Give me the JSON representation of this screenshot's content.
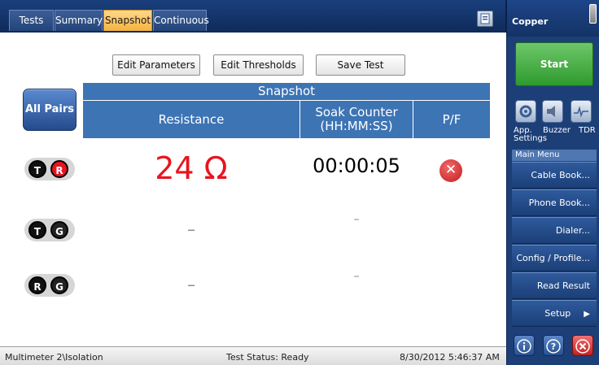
{
  "tabs": {
    "tests": "Tests",
    "summary": "Summary",
    "snapshot": "Snapshot",
    "continuous": "Continuous",
    "active": "Snapshot"
  },
  "toolbar": {
    "edit_parameters": "Edit Parameters",
    "edit_thresholds": "Edit Thresholds",
    "save_test": "Save Test"
  },
  "table": {
    "all_pairs_label": "All Pairs",
    "title": "Snapshot",
    "columns": {
      "resistance": "Resistance",
      "soak_counter_line1": "Soak Counter",
      "soak_counter_line2": "(HH:MM:SS)",
      "pf": "P/F"
    },
    "rows": [
      {
        "pair": [
          "T",
          "R"
        ],
        "resistance": "24 Ω",
        "soak": "00:00:05",
        "pf": "fail-icon"
      },
      {
        "pair": [
          "T",
          "G"
        ],
        "resistance": "–",
        "soak": "–",
        "pf": ""
      },
      {
        "pair": [
          "R",
          "G"
        ],
        "resistance": "–",
        "soak": "–",
        "pf": ""
      }
    ]
  },
  "status_bar": {
    "path": "Multimeter 2\\Isolation",
    "test_status": "Test Status: Ready",
    "datetime": "8/30/2012 5:46:37 AM"
  },
  "panel": {
    "section": "Copper",
    "start": "Start",
    "tools": {
      "app_settings_line1": "App.",
      "app_settings_line2": "Settings",
      "buzzer": "Buzzer",
      "tdr": "TDR"
    },
    "menu_header": "Main Menu",
    "menu": [
      "Cable Book...",
      "Phone Book...",
      "Dialer...",
      "Config / Profile...",
      "Read Result File...",
      "Setup"
    ]
  },
  "colors": {
    "resistance_value": "#e8141e",
    "header_blue": "#3d74b4",
    "active_tab": "#f5b342",
    "start_green": "#2e9a2d"
  }
}
